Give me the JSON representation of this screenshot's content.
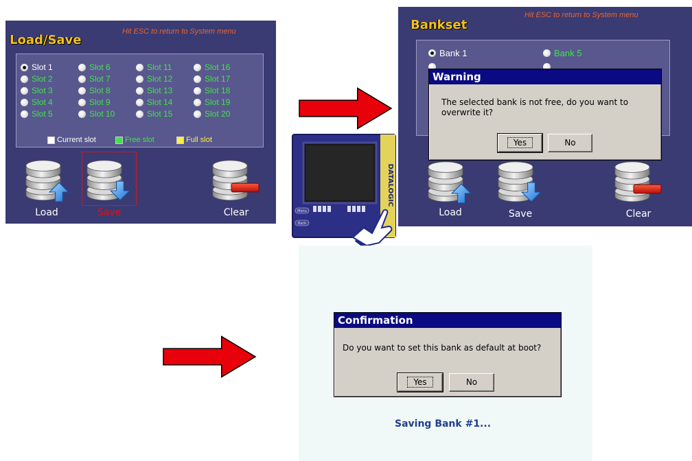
{
  "load_save_screen": {
    "title": "Load/Save",
    "esc_hint": "Hit ESC to return to System menu",
    "slots": [
      "Slot 1",
      "Slot 2",
      "Slot 3",
      "Slot 4",
      "Slot 5",
      "Slot 6",
      "Slot 7",
      "Slot 8",
      "Slot 9",
      "Slot 10",
      "Slot 11",
      "Slot 12",
      "Slot 13",
      "Slot 14",
      "Slot 15",
      "Slot 16",
      "Slot 17",
      "Slot 18",
      "Slot 19",
      "Slot 20"
    ],
    "selected_slot": "Slot 1",
    "legend": {
      "current": "Current slot",
      "free": "Free slot",
      "full": "Full slot"
    },
    "actions": {
      "load": "Load",
      "save": "Save",
      "clear": "Clear"
    },
    "selected_action": "Save"
  },
  "bankset_screen": {
    "title": "Bankset",
    "esc_hint": "Hit ESC to return to System menu",
    "banks_visible": [
      "Bank 1",
      "Bank 5"
    ],
    "selected_bank": "Bank 1",
    "actions": {
      "load": "Load",
      "save": "Save",
      "clear": "Clear"
    },
    "warning_dialog": {
      "title": "Warning",
      "message": "The selected bank is not free, do you want to overwrite it?",
      "yes": "Yes",
      "no": "No"
    }
  },
  "confirmation_panel": {
    "dialog": {
      "title": "Confirmation",
      "message": "Do you want to set this bank as default at boot?",
      "yes": "Yes",
      "no": "No"
    },
    "status": "Saving Bank #1..."
  },
  "device": {
    "brand": "DATALOGIC",
    "key_labels": [
      "Menu",
      "Back"
    ]
  },
  "colors": {
    "screen_bg": "#3a3b73",
    "slot_box": "#58588e",
    "free_green": "#44e14a",
    "full_yellow": "#ffee44",
    "title_yellow": "#f3c21a",
    "esc_orange": "#e8652b",
    "dialog_title_blue": "#0a0a82",
    "arrow_red": "#e8000b",
    "saving_blue": "#1f3f8a"
  }
}
